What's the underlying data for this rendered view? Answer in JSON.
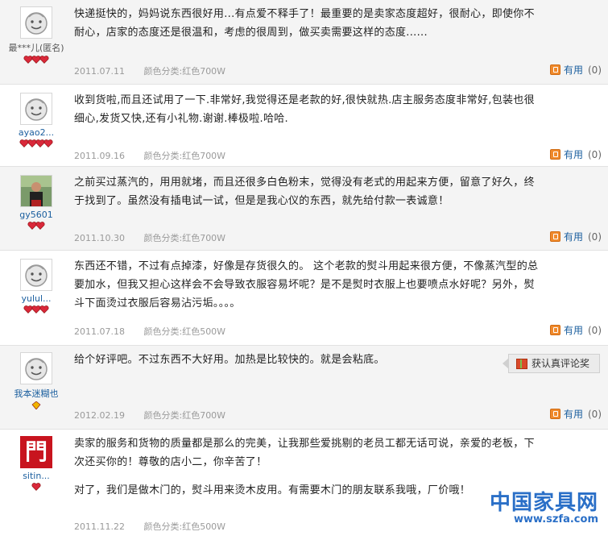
{
  "reviews": [
    {
      "username": "最***儿(匿名)",
      "rank_icons": 3,
      "rank_color": "#d9283a",
      "content": [
        "快递挺快的，妈妈说东西很好用...有点爱不释手了！最重要的是卖家态度超好，很耐心，即使你不耐心，店家的态度还是很温和，考虑的很周到，做买卖需要这样的态度......"
      ],
      "date": "2011.07.11",
      "sku": "颜色分类:红色700W",
      "useful_label": "有用",
      "useful_count": "(0)"
    },
    {
      "username": "ayao2...",
      "rank_icons": 4,
      "rank_color": "#d9283a",
      "content": [
        "收到货啦,而且还试用了一下.非常好,我觉得还是老款的好,很快就热.店主服务态度非常好,包装也很细心,发货又快,还有小礼物.谢谢.棒极啦.哈哈."
      ],
      "date": "2011.09.16",
      "sku": "颜色分类:红色700W",
      "useful_label": "有用",
      "useful_count": "(0)"
    },
    {
      "username": "gy5601",
      "rank_icons": 2,
      "rank_color": "#d9283a",
      "content": [
        "之前买过蒸汽的，用用就堵，而且还很多白色粉末，觉得没有老式的用起来方便，留意了好久，终于找到了。虽然没有插电试一试，但是是我心仪的东西，就先给付款一表诚意！"
      ],
      "date": "2011.10.30",
      "sku": "颜色分类:红色700W",
      "useful_label": "有用",
      "useful_count": "(0)"
    },
    {
      "username": "yulul...",
      "rank_icons": 3,
      "rank_color": "#d9283a",
      "content": [
        "东西还不错，不过有点掉漆，好像是存货很久的。 这个老款的熨斗用起来很方便，不像蒸汽型的总要加水，但我又担心这样会不会导致衣服容易坏呢？是不是熨时衣服上也要喷点水好呢？另外，熨斗下面烫过衣服后容易沾污垢。。。。"
      ],
      "date": "2011.07.18",
      "sku": "颜色分类:红色500W",
      "useful_label": "有用",
      "useful_count": "(0)"
    },
    {
      "username": "我本迷糊也",
      "rank_icons": 1,
      "rank_color": "#f0b400",
      "content": [
        "给个好评吧。不过东西不大好用。加热是比较快的。就是会粘底。"
      ],
      "date": "2012.02.19",
      "sku": "颜色分类:红色700W",
      "useful_label": "有用",
      "useful_count": "(0)",
      "award_label": "获认真评论奖"
    },
    {
      "username": "sitin...",
      "rank_icons": 1,
      "rank_color": "#d9283a",
      "avatar_char": "門",
      "content": [
        "卖家的服务和货物的质量都是那么的完美，让我那些爱挑剔的老员工都无话可说，亲爱的老板，下次还买你的！尊敬的店小二，你辛苦了！",
        "对了，我们是做木门的，熨斗用来烫木皮用。有需要木门的朋友联系我哦，厂价哦！"
      ],
      "date": "2011.11.22",
      "sku": "颜色分类:红色500W",
      "useful_label": "有用",
      "useful_count": "(0)"
    }
  ],
  "watermark": {
    "cn": "中国家具网",
    "url": "www.szfa.com"
  },
  "icons": {
    "default_avatar": "smiley-avatar-icon",
    "rank": "heart-rank-icon",
    "useful": "thumb-up-icon",
    "award": "gift-icon"
  }
}
